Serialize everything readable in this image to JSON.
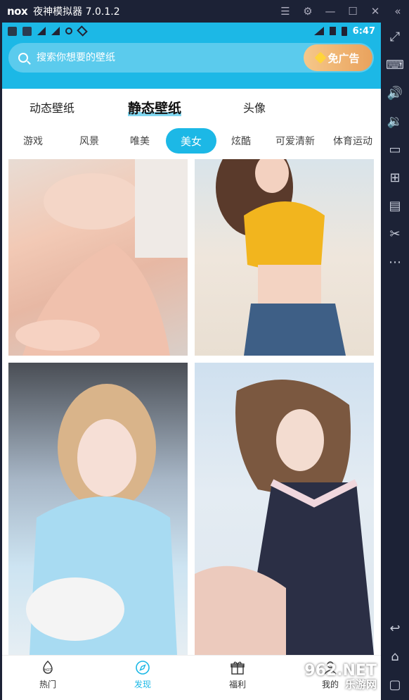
{
  "window": {
    "logo": "nox",
    "title": "夜神模拟器 7.0.1.2"
  },
  "status_bar": {
    "time": "6:47"
  },
  "search": {
    "placeholder": "搜索你想要的壁纸",
    "noad_label": "免广告"
  },
  "main_tabs": [
    {
      "label": "动态壁纸"
    },
    {
      "label": "静态壁纸"
    },
    {
      "label": "头像"
    }
  ],
  "categories": [
    {
      "label": "游戏"
    },
    {
      "label": "风景"
    },
    {
      "label": "唯美"
    },
    {
      "label": "美女"
    },
    {
      "label": "炫酷"
    },
    {
      "label": "可爱清新"
    },
    {
      "label": "体育运动"
    }
  ],
  "bottom_nav": [
    {
      "label": "热门",
      "icon": "hot-icon"
    },
    {
      "label": "发现",
      "icon": "compass-icon"
    },
    {
      "label": "福利",
      "icon": "gift-icon"
    },
    {
      "label": "我的",
      "icon": "user-icon"
    }
  ],
  "watermark": {
    "line1": "962.NET",
    "line2": "乐游网"
  },
  "colors": {
    "accent": "#1cb8e6",
    "noad_gradient_start": "#f6c88a",
    "noad_gradient_end": "#e9a25d",
    "frame": "#1c2236"
  }
}
